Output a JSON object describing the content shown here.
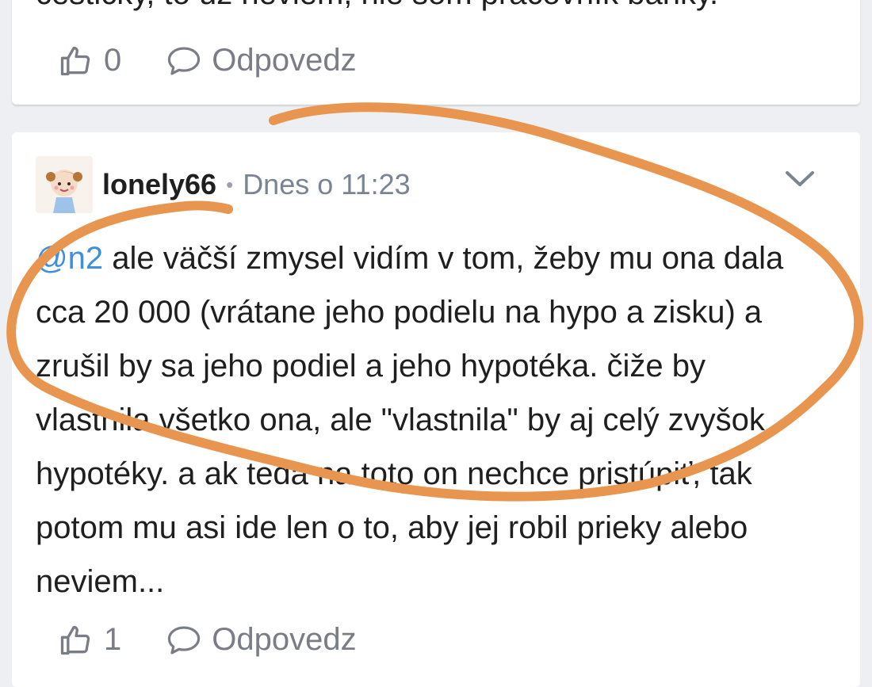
{
  "previous_comment": {
    "text_fragment": "čestičky, to už neviem, nie som pracovník banky.",
    "likes": "0",
    "reply_label": "Odpovedz"
  },
  "comment": {
    "author": "lonely66",
    "separator": "•",
    "timestamp": "Dnes o 11:23",
    "mention": "@n2",
    "text": " ale väčší zmysel vidím v tom, žeby mu ona dala cca 20 000 (vrátane jeho podielu na hypo a zisku) a zrušil by sa jeho podiel a jeho hypotéka. čiže by vlastnila všetko ona, ale \"vlastnila\" by aj celý zvyšok hypotéky. a ak teda na toto on nechce pristúpiť, tak potom mu asi ide len o to, aby jej robil prieky alebo neviem...",
    "likes": "1",
    "reply_label": "Odpovedz"
  },
  "icons": {
    "like": "thumbs-up-icon",
    "reply": "speech-bubble-icon",
    "expand": "chevron-down-icon"
  },
  "colors": {
    "mention": "#3d8fe0",
    "annotation_stroke": "#e8954f",
    "muted": "#7a7d85"
  }
}
